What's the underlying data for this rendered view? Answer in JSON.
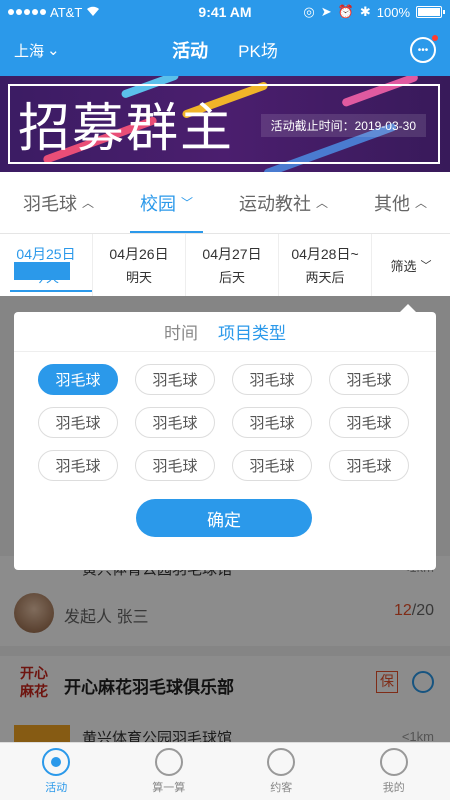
{
  "status_bar": {
    "carrier": "AT&T",
    "time": "9:41 AM",
    "battery": "100%"
  },
  "nav": {
    "city": "上海",
    "tabs": [
      "活动",
      "PK场"
    ],
    "active_tab": 0
  },
  "banner": {
    "title": "招募群主",
    "deadline": "活动截止时间：2019-03-30"
  },
  "categories": [
    {
      "label": "羽毛球",
      "active": false
    },
    {
      "label": "校园",
      "active": true
    },
    {
      "label": "运动教社",
      "active": false
    },
    {
      "label": "其他",
      "active": false
    }
  ],
  "dates": [
    {
      "date": "04月25日",
      "label": "今天",
      "active": true
    },
    {
      "date": "04月26日",
      "label": "明天",
      "active": false
    },
    {
      "date": "04月27日",
      "label": "后天",
      "active": false
    },
    {
      "date": "04月28日~",
      "label": "两天后",
      "active": false
    }
  ],
  "filter_label": "筛选",
  "popup": {
    "tabs": [
      "时间",
      "项目类型"
    ],
    "active_tab": 1,
    "chips": [
      "羽毛球",
      "羽毛球",
      "羽毛球",
      "羽毛球",
      "羽毛球",
      "羽毛球",
      "羽毛球",
      "羽毛球",
      "羽毛球",
      "羽毛球",
      "羽毛球",
      "羽毛球"
    ],
    "selected_chip": 0,
    "confirm_label": "确定"
  },
  "list": {
    "card1": {
      "venue": "黄兴体育公园羽毛球馆",
      "distance": "<1km",
      "initiator": "发起人 张三",
      "joined": "12",
      "capacity": "/20"
    },
    "club": {
      "logo_text": "开心麻花",
      "name": "开心麻花羽毛球俱乐部",
      "badge": "保"
    },
    "card2": {
      "venue": "黄兴体育公园羽毛球馆",
      "distance": "<1km"
    }
  },
  "tabbar": [
    {
      "label": "活动",
      "icon": "activity-icon",
      "active": true
    },
    {
      "label": "算一算",
      "icon": "calculator-icon",
      "active": false
    },
    {
      "label": "约客",
      "icon": "meet-icon",
      "active": false
    },
    {
      "label": "我的",
      "icon": "profile-icon",
      "active": false
    }
  ],
  "colors": {
    "primary": "#2b99ea",
    "accent": "#e8512b",
    "banner_bg": "#3b1c63"
  }
}
